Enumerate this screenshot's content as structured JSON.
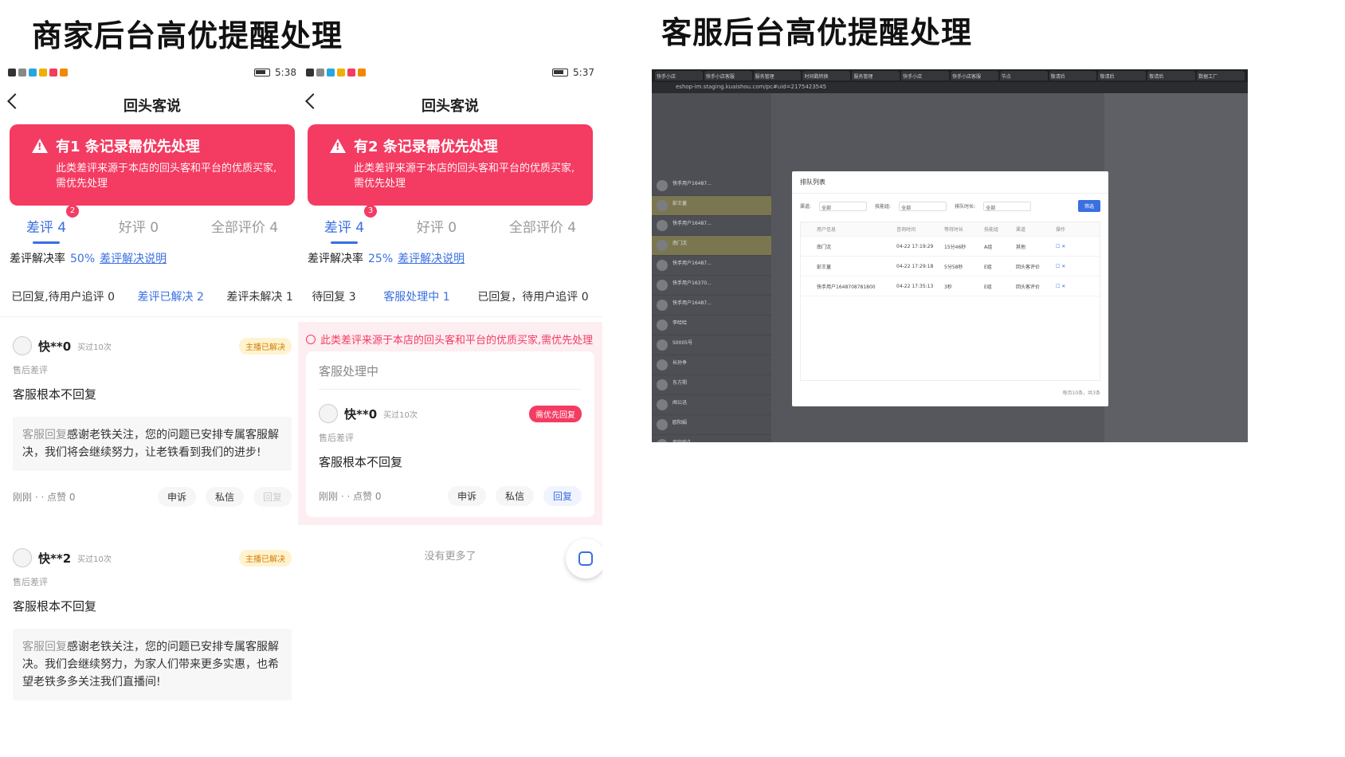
{
  "headings": {
    "left": "商家后台高优提醒处理",
    "right": "客服后台高优提醒处理"
  },
  "phone1": {
    "time": "5:38",
    "nav_title": "回头客说",
    "banner_title": "有1 条记录需优先处理",
    "banner_desc": "此类差评来源于本店的回头客和平台的优质买家,需优先处理",
    "tabs": [
      {
        "label": "差评 4",
        "badge": "2"
      },
      {
        "label": "好评 0"
      },
      {
        "label": "全部评价 4"
      }
    ],
    "rate_label": "差评解决率",
    "rate_value": "50%",
    "rate_link": "差评解决说明",
    "subtabs": [
      "已回复,待用户追评 0",
      "差评已解决 2",
      "差评未解决 1"
    ],
    "cards": [
      {
        "user": "快**0",
        "buy": "买过10次",
        "tag": "主播已解决",
        "meta": "售后差评",
        "content": "客服根本不回复",
        "reply_label": "客服回复",
        "reply": "感谢老铁关注，您的问题已安排专属客服解决，我们将会继续努力，让老铁看到我们的进步!",
        "time": "刚刚 · · 点赞 0",
        "a1": "申诉",
        "a2": "私信",
        "a3": "回复"
      },
      {
        "user": "快**2",
        "buy": "买过10次",
        "tag": "主播已解决",
        "meta": "售后差评",
        "content": "客服根本不回复",
        "reply_label": "客服回复",
        "reply": "感谢老铁关注，您的问题已安排专属客服解决。我们会继续努力，为家人们带来更多实惠，也希望老铁多多关注我们直播间!"
      }
    ]
  },
  "phone2": {
    "time": "5:37",
    "nav_title": "回头客说",
    "banner_title": "有2 条记录需优先处理",
    "banner_desc": "此类差评来源于本店的回头客和平台的优质买家,需优先处理",
    "tabs": [
      {
        "label": "差评 4",
        "badge": "3"
      },
      {
        "label": "好评 0"
      },
      {
        "label": "全部评价 4"
      }
    ],
    "rate_label": "差评解决率",
    "rate_value": "25%",
    "rate_link": "差评解决说明",
    "subtabs": [
      "待回复 3",
      "客服处理中 1",
      "已回复，待用户追评 0"
    ],
    "pink_note": "此类差评来源于本店的回头客和平台的优质买家,需优先处理",
    "proc_title": "客服处理中",
    "card": {
      "user": "快**0",
      "buy": "买过10次",
      "tag": "需优先回复",
      "meta": "售后差评",
      "content": "客服根本不回复",
      "time": "刚刚 · · 点赞 0",
      "a1": "申诉",
      "a2": "私信",
      "a3": "回复"
    },
    "no_more": "没有更多了"
  },
  "desktop": {
    "url": "eshop-im.staging.kuaishou.com/pc#uid=2175423545",
    "tabs": [
      "快手小店",
      "快手小店客服",
      "服务管理",
      "时间戳转换",
      "服务管理",
      "快手小店",
      "快手小店客服",
      "节点",
      "敬请后",
      "敬请后",
      "敬请后",
      "数据工厂"
    ],
    "modal_title": "排队列表",
    "filters": [
      "渠道:",
      "技能组:",
      "排队时长:"
    ],
    "filter_value": "全部",
    "filter_btn": "筛选",
    "columns": [
      "用户信息",
      "咨询时间",
      "等待时长",
      "技能组",
      "渠道",
      "操作"
    ],
    "rows": [
      [
        "南门沈",
        "04-22 17:19:29",
        "15分46秒",
        "A组",
        "其他"
      ],
      [
        "彭王童",
        "04-22 17:29:18",
        "5分58秒",
        "E组",
        "回头客评价"
      ],
      [
        "快手用户1648708781800",
        "04-22 17:35:13",
        "3秒",
        "E组",
        "回头客评价"
      ]
    ],
    "pager": "每页10条，共3条",
    "left_items": [
      "快手用户16487...",
      "彭王童",
      "快手用户16487...",
      "南门沈",
      "快手用户16487...",
      "快手用户16370...",
      "快手用户16487...",
      "李哈哈",
      "S0005号",
      "长孙争",
      "东方朔",
      "闻公迅",
      "欧阳娟",
      "司空骏久"
    ]
  }
}
